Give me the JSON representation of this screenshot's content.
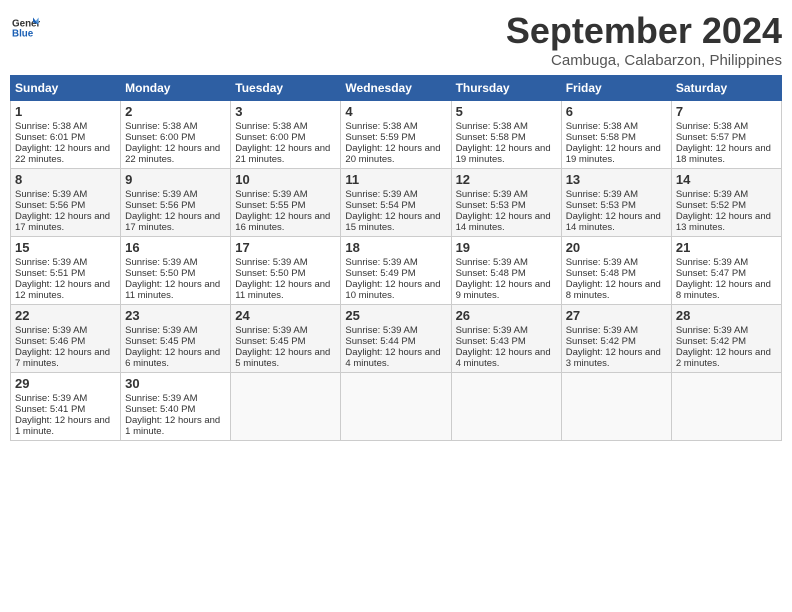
{
  "logo": {
    "general": "General",
    "blue": "Blue"
  },
  "header": {
    "month": "September 2024",
    "location": "Cambuga, Calabarzon, Philippines"
  },
  "days_of_week": [
    "Sunday",
    "Monday",
    "Tuesday",
    "Wednesday",
    "Thursday",
    "Friday",
    "Saturday"
  ],
  "weeks": [
    [
      {
        "day": "1",
        "sunrise": "Sunrise: 5:38 AM",
        "sunset": "Sunset: 6:01 PM",
        "daylight": "Daylight: 12 hours and 22 minutes."
      },
      {
        "day": "2",
        "sunrise": "Sunrise: 5:38 AM",
        "sunset": "Sunset: 6:00 PM",
        "daylight": "Daylight: 12 hours and 22 minutes."
      },
      {
        "day": "3",
        "sunrise": "Sunrise: 5:38 AM",
        "sunset": "Sunset: 6:00 PM",
        "daylight": "Daylight: 12 hours and 21 minutes."
      },
      {
        "day": "4",
        "sunrise": "Sunrise: 5:38 AM",
        "sunset": "Sunset: 5:59 PM",
        "daylight": "Daylight: 12 hours and 20 minutes."
      },
      {
        "day": "5",
        "sunrise": "Sunrise: 5:38 AM",
        "sunset": "Sunset: 5:58 PM",
        "daylight": "Daylight: 12 hours and 19 minutes."
      },
      {
        "day": "6",
        "sunrise": "Sunrise: 5:38 AM",
        "sunset": "Sunset: 5:58 PM",
        "daylight": "Daylight: 12 hours and 19 minutes."
      },
      {
        "day": "7",
        "sunrise": "Sunrise: 5:38 AM",
        "sunset": "Sunset: 5:57 PM",
        "daylight": "Daylight: 12 hours and 18 minutes."
      }
    ],
    [
      {
        "day": "8",
        "sunrise": "Sunrise: 5:39 AM",
        "sunset": "Sunset: 5:56 PM",
        "daylight": "Daylight: 12 hours and 17 minutes."
      },
      {
        "day": "9",
        "sunrise": "Sunrise: 5:39 AM",
        "sunset": "Sunset: 5:56 PM",
        "daylight": "Daylight: 12 hours and 17 minutes."
      },
      {
        "day": "10",
        "sunrise": "Sunrise: 5:39 AM",
        "sunset": "Sunset: 5:55 PM",
        "daylight": "Daylight: 12 hours and 16 minutes."
      },
      {
        "day": "11",
        "sunrise": "Sunrise: 5:39 AM",
        "sunset": "Sunset: 5:54 PM",
        "daylight": "Daylight: 12 hours and 15 minutes."
      },
      {
        "day": "12",
        "sunrise": "Sunrise: 5:39 AM",
        "sunset": "Sunset: 5:53 PM",
        "daylight": "Daylight: 12 hours and 14 minutes."
      },
      {
        "day": "13",
        "sunrise": "Sunrise: 5:39 AM",
        "sunset": "Sunset: 5:53 PM",
        "daylight": "Daylight: 12 hours and 14 minutes."
      },
      {
        "day": "14",
        "sunrise": "Sunrise: 5:39 AM",
        "sunset": "Sunset: 5:52 PM",
        "daylight": "Daylight: 12 hours and 13 minutes."
      }
    ],
    [
      {
        "day": "15",
        "sunrise": "Sunrise: 5:39 AM",
        "sunset": "Sunset: 5:51 PM",
        "daylight": "Daylight: 12 hours and 12 minutes."
      },
      {
        "day": "16",
        "sunrise": "Sunrise: 5:39 AM",
        "sunset": "Sunset: 5:50 PM",
        "daylight": "Daylight: 12 hours and 11 minutes."
      },
      {
        "day": "17",
        "sunrise": "Sunrise: 5:39 AM",
        "sunset": "Sunset: 5:50 PM",
        "daylight": "Daylight: 12 hours and 11 minutes."
      },
      {
        "day": "18",
        "sunrise": "Sunrise: 5:39 AM",
        "sunset": "Sunset: 5:49 PM",
        "daylight": "Daylight: 12 hours and 10 minutes."
      },
      {
        "day": "19",
        "sunrise": "Sunrise: 5:39 AM",
        "sunset": "Sunset: 5:48 PM",
        "daylight": "Daylight: 12 hours and 9 minutes."
      },
      {
        "day": "20",
        "sunrise": "Sunrise: 5:39 AM",
        "sunset": "Sunset: 5:48 PM",
        "daylight": "Daylight: 12 hours and 8 minutes."
      },
      {
        "day": "21",
        "sunrise": "Sunrise: 5:39 AM",
        "sunset": "Sunset: 5:47 PM",
        "daylight": "Daylight: 12 hours and 8 minutes."
      }
    ],
    [
      {
        "day": "22",
        "sunrise": "Sunrise: 5:39 AM",
        "sunset": "Sunset: 5:46 PM",
        "daylight": "Daylight: 12 hours and 7 minutes."
      },
      {
        "day": "23",
        "sunrise": "Sunrise: 5:39 AM",
        "sunset": "Sunset: 5:45 PM",
        "daylight": "Daylight: 12 hours and 6 minutes."
      },
      {
        "day": "24",
        "sunrise": "Sunrise: 5:39 AM",
        "sunset": "Sunset: 5:45 PM",
        "daylight": "Daylight: 12 hours and 5 minutes."
      },
      {
        "day": "25",
        "sunrise": "Sunrise: 5:39 AM",
        "sunset": "Sunset: 5:44 PM",
        "daylight": "Daylight: 12 hours and 4 minutes."
      },
      {
        "day": "26",
        "sunrise": "Sunrise: 5:39 AM",
        "sunset": "Sunset: 5:43 PM",
        "daylight": "Daylight: 12 hours and 4 minutes."
      },
      {
        "day": "27",
        "sunrise": "Sunrise: 5:39 AM",
        "sunset": "Sunset: 5:42 PM",
        "daylight": "Daylight: 12 hours and 3 minutes."
      },
      {
        "day": "28",
        "sunrise": "Sunrise: 5:39 AM",
        "sunset": "Sunset: 5:42 PM",
        "daylight": "Daylight: 12 hours and 2 minutes."
      }
    ],
    [
      {
        "day": "29",
        "sunrise": "Sunrise: 5:39 AM",
        "sunset": "Sunset: 5:41 PM",
        "daylight": "Daylight: 12 hours and 1 minute."
      },
      {
        "day": "30",
        "sunrise": "Sunrise: 5:39 AM",
        "sunset": "Sunset: 5:40 PM",
        "daylight": "Daylight: 12 hours and 1 minute."
      },
      null,
      null,
      null,
      null,
      null
    ]
  ]
}
